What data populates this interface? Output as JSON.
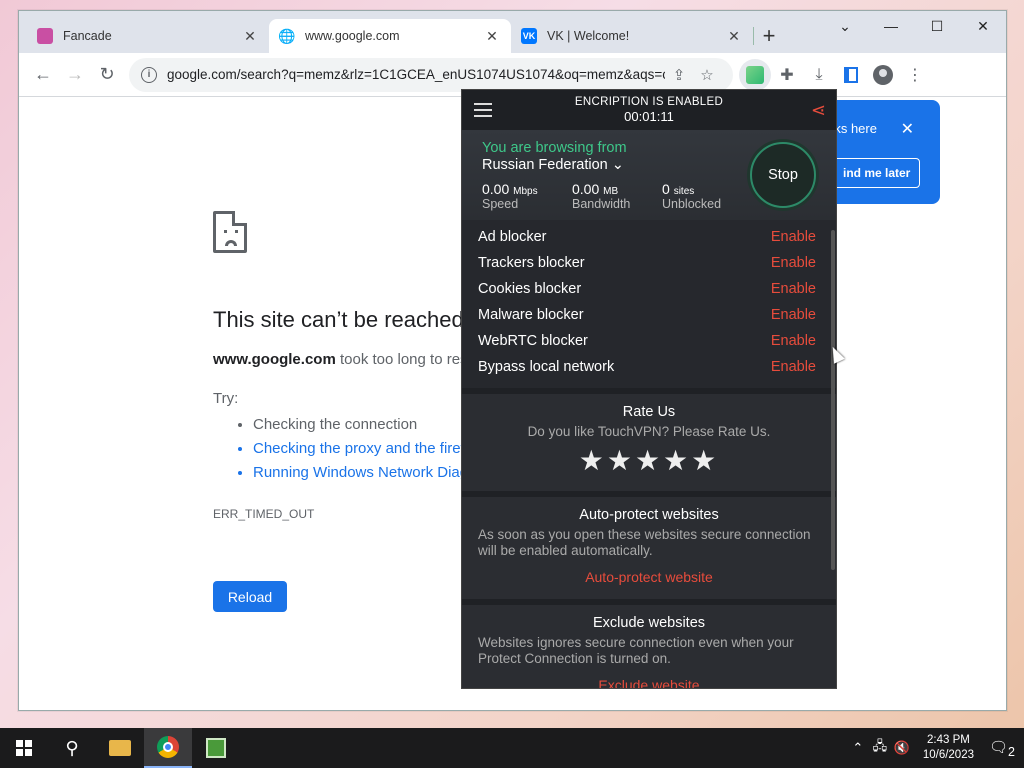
{
  "tabs": [
    {
      "title": "Fancade",
      "active": false,
      "favicon_color": "#c94fa3"
    },
    {
      "title": "www.google.com",
      "active": true,
      "favicon_color": "#5f6368"
    },
    {
      "title": "VK | Welcome!",
      "active": false,
      "favicon_color": "#0077ff"
    }
  ],
  "window": {
    "minimize": "—",
    "maximize": "☐",
    "close": "✕",
    "tab_search": "⌄",
    "new_tab": "+"
  },
  "address_bar": {
    "url": "google.com/search?q=memz&rlz=1C1GCEA_enUS1074US1074&oq=memz&aqs=chrome...."
  },
  "error_page": {
    "title": "This site can’t be reached",
    "host": "www.google.com",
    "desc_suffix": " took too long to respond.",
    "try_label": "Try:",
    "suggestions": [
      "Checking the connection",
      "Checking the proxy and the firewall",
      "Running Windows Network Diagnostics"
    ],
    "error_code": "ERR_TIMED_OUT",
    "reload_label": "Reload"
  },
  "bubble": {
    "text": "rks here",
    "button": "ind me later",
    "close": "✕"
  },
  "vpn": {
    "header_title": "ENCRIPTION IS ENABLED",
    "timer": "00:01:11",
    "browsing_label": "You are browsing from",
    "country": "Russian Federation",
    "stop_label": "Stop",
    "stats": [
      {
        "value": "0.00",
        "unit": "Mbps",
        "label": "Speed"
      },
      {
        "value": "0.00",
        "unit": "MB",
        "label": "Bandwidth"
      },
      {
        "value": "0",
        "unit": "sites",
        "label": "Unblocked"
      }
    ],
    "blockers": [
      {
        "name": "Ad blocker",
        "action": "Enable"
      },
      {
        "name": "Trackers blocker",
        "action": "Enable"
      },
      {
        "name": "Cookies blocker",
        "action": "Enable"
      },
      {
        "name": "Malware blocker",
        "action": "Enable"
      },
      {
        "name": "WebRTC blocker",
        "action": "Enable"
      },
      {
        "name": "Bypass local network",
        "action": "Enable"
      }
    ],
    "rate": {
      "title": "Rate Us",
      "text": "Do you like TouchVPN? Please Rate Us.",
      "stars": "★★★★★"
    },
    "auto_protect": {
      "title": "Auto-protect websites",
      "text": "As soon as you open these websites secure connection will be enabled automatically.",
      "link": "Auto-protect website"
    },
    "exclude": {
      "title": "Exclude websites",
      "text": "Websites ignores secure connection even when your Protect Connection is turned on.",
      "link": "Exclude website"
    }
  },
  "taskbar": {
    "time": "2:43 PM",
    "date": "10/6/2023",
    "notifications": "2"
  }
}
